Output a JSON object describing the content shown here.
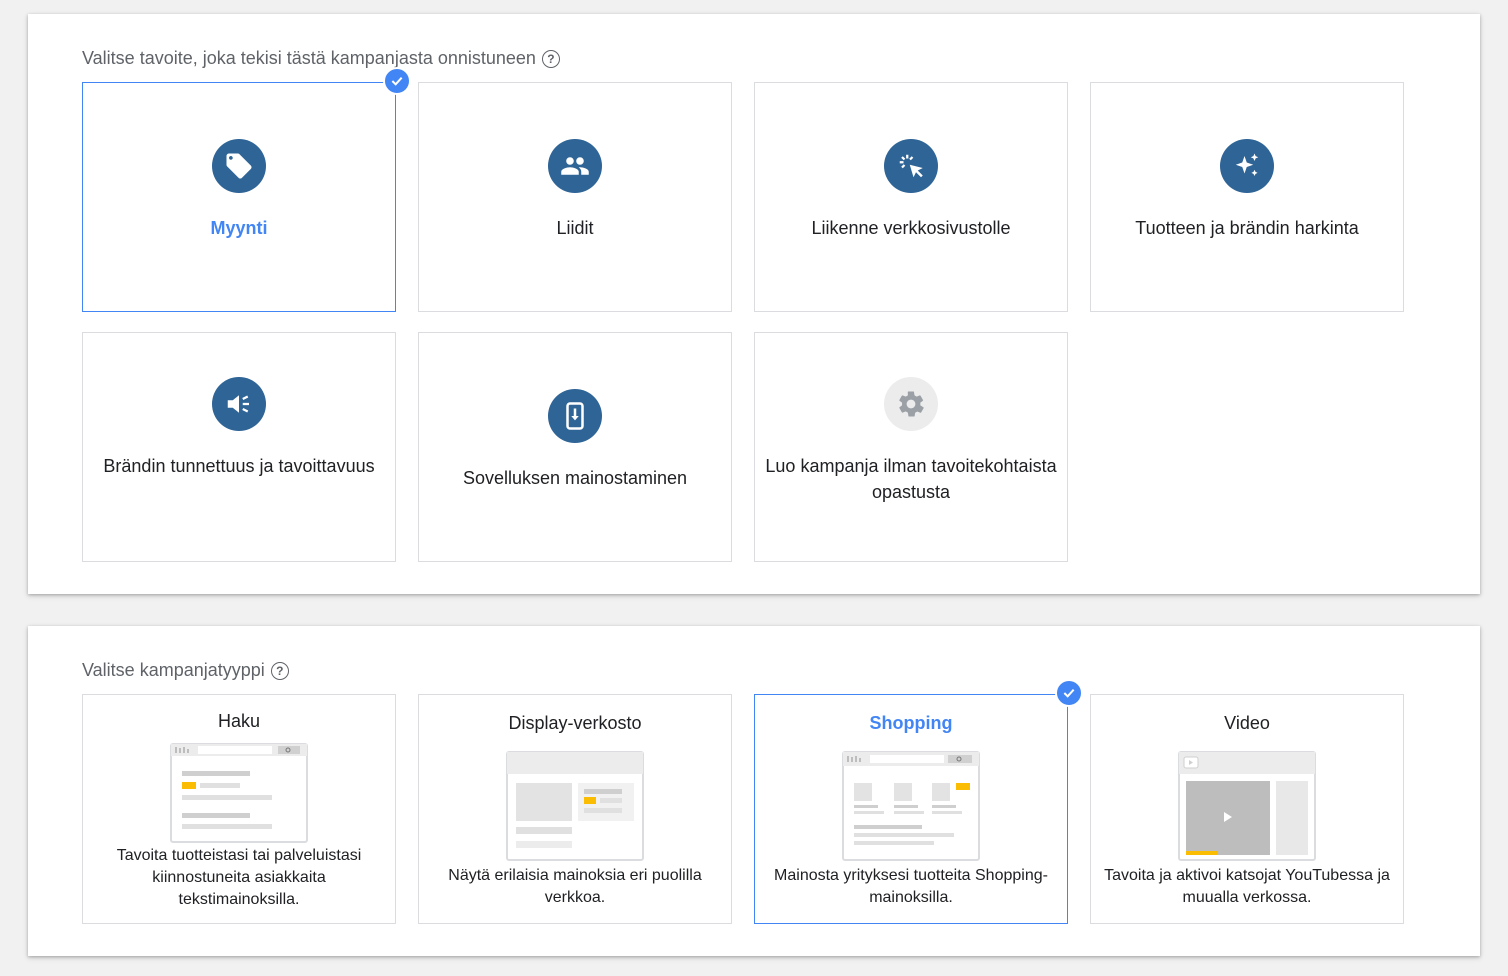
{
  "goals_section": {
    "heading": "Valitse tavoite, joka tekisi tästä kampanjasta onnistuneen",
    "help": "?",
    "cards": [
      {
        "label": "Myynti",
        "icon": "sales-tag-icon",
        "selected": true
      },
      {
        "label": "Liidit",
        "icon": "people-icon",
        "selected": false
      },
      {
        "label": "Liikenne verkkosivustolle",
        "icon": "cursor-click-icon",
        "selected": false
      },
      {
        "label": "Tuotteen ja brändin harkinta",
        "icon": "sparkle-icon",
        "selected": false
      },
      {
        "label": "Brändin tunnettuus ja tavoittavuus",
        "icon": "megaphone-icon",
        "selected": false
      },
      {
        "label": "Sovelluksen mainostaminen",
        "icon": "mobile-download-icon",
        "selected": false
      },
      {
        "label": "Luo kampanja ilman tavoitekohtaista opastusta",
        "icon": "gear-icon",
        "selected": false
      }
    ]
  },
  "types_section": {
    "heading": "Valitse kampanjatyyppi",
    "help": "?",
    "cards": [
      {
        "title": "Haku",
        "description": "Tavoita tuotteistasi tai palveluistasi kiinnostuneita asiakkaita tekstimainoksilla.",
        "selected": false
      },
      {
        "title": "Display-verkosto",
        "description": "Näytä erilaisia mainoksia eri puolilla verkkoa.",
        "selected": false
      },
      {
        "title": "Shopping",
        "description": "Mainosta yrityksesi tuotteita Shopping-mainoksilla.",
        "selected": true
      },
      {
        "title": "Video",
        "description": "Tavoita ja aktivoi katsojat YouTubessa ja muualla verkossa.",
        "selected": false
      }
    ]
  },
  "colors": {
    "accent": "#4285f4",
    "icon_bg": "#2f6496",
    "border": "#dadce0",
    "ad_highlight": "#fbbc04"
  }
}
